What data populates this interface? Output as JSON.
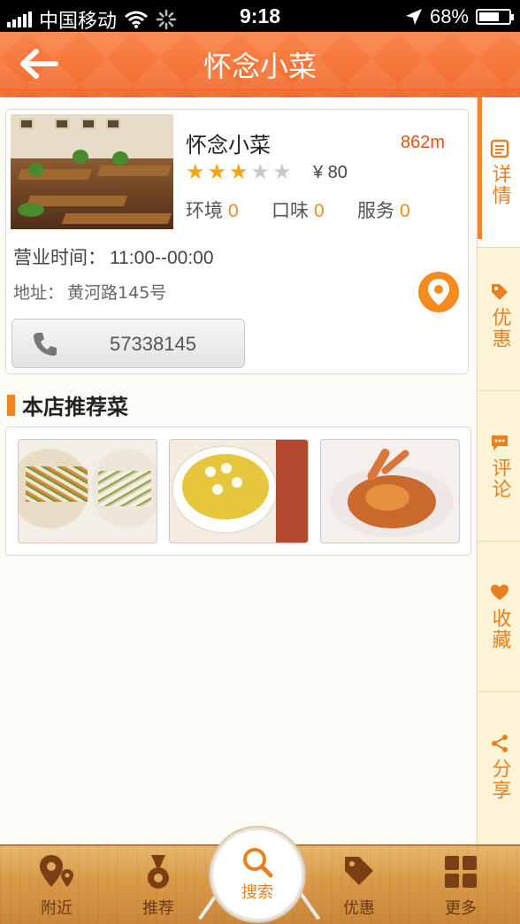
{
  "status_bar": {
    "carrier": "中国移动",
    "time": "9:18",
    "battery": "68%"
  },
  "nav": {
    "title": "怀念小菜",
    "back_icon": "back-arrow-icon"
  },
  "shop": {
    "name": "怀念小菜",
    "distance": "862m",
    "stars_total": 5,
    "stars_filled": 3,
    "price": "¥ 80",
    "ratings": [
      {
        "label": "环境",
        "value": "0"
      },
      {
        "label": "口味",
        "value": "0"
      },
      {
        "label": "服务",
        "value": "0"
      }
    ],
    "hours_label": "营业时间：",
    "hours_value": "11:00--00:00",
    "address_label": "地址：",
    "address_value": "黄河路145号",
    "phone": "57338145"
  },
  "recommend": {
    "title": "本店推荐菜",
    "dishes_count": 3
  },
  "side_tabs": [
    {
      "label": "详情",
      "icon": "detail-icon",
      "active": true
    },
    {
      "label": "优惠",
      "icon": "tag-icon",
      "active": false
    },
    {
      "label": "评论",
      "icon": "comment-icon",
      "active": false
    },
    {
      "label": "收藏",
      "icon": "heart-icon",
      "active": false
    },
    {
      "label": "分享",
      "icon": "share-icon",
      "active": false
    }
  ],
  "bottom_tabs": [
    {
      "label": "附近",
      "icon": "location-icon"
    },
    {
      "label": "推荐",
      "icon": "medal-icon"
    },
    {
      "label": "搜索",
      "icon": "search-icon"
    },
    {
      "label": "优惠",
      "icon": "tag-icon"
    },
    {
      "label": "更多",
      "icon": "grid-icon"
    }
  ],
  "colors": {
    "accent": "#f26a2c",
    "orange_text": "#f08a1c",
    "rail_bg": "#fdf4d8",
    "wood": "#d99a48"
  }
}
